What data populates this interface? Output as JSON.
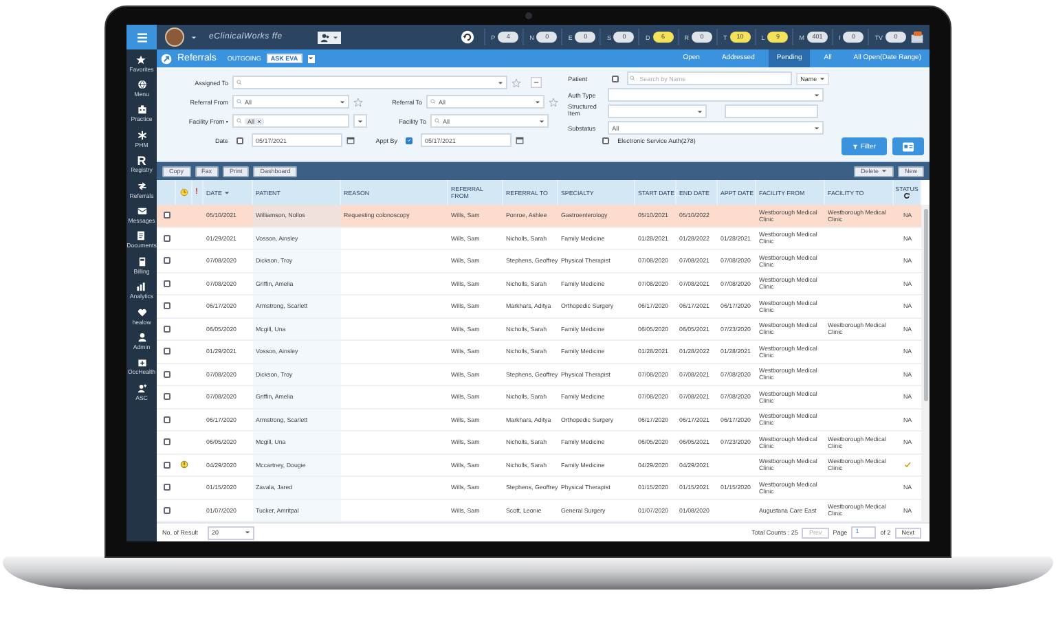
{
  "app": {
    "title": "eClinicalWorks ffe",
    "counters": [
      {
        "letter": "P",
        "count": "4",
        "highlighted": false
      },
      {
        "letter": "N",
        "count": "0",
        "highlighted": false
      },
      {
        "letter": "E",
        "count": "0",
        "highlighted": false
      },
      {
        "letter": "S",
        "count": "0",
        "highlighted": false
      },
      {
        "letter": "D",
        "count": "6",
        "highlighted": true
      },
      {
        "letter": "R",
        "count": "0",
        "highlighted": false
      },
      {
        "letter": "T",
        "count": "10",
        "highlighted": true
      },
      {
        "letter": "L",
        "count": "9",
        "highlighted": true
      },
      {
        "letter": "M",
        "count": "401",
        "highlighted": false
      },
      {
        "letter": "I",
        "count": "0",
        "highlighted": false
      },
      {
        "letter": "TV",
        "count": "0",
        "highlighted": false
      }
    ]
  },
  "sidebar": {
    "items": [
      {
        "label": "Favorites"
      },
      {
        "label": "Menu"
      },
      {
        "label": "Practice"
      },
      {
        "label": "PHM"
      },
      {
        "label": "Registry",
        "glyph": "R"
      },
      {
        "label": "Referrals"
      },
      {
        "label": "Messages"
      },
      {
        "label": "Documents"
      },
      {
        "label": "Billing"
      },
      {
        "label": "Analytics"
      },
      {
        "label": "healow"
      },
      {
        "label": "Admin"
      },
      {
        "label": "OccHealth"
      },
      {
        "label": "ASC"
      }
    ]
  },
  "module": {
    "title": "Referrals",
    "direction": "OUTGOING",
    "badge": "ASK EVA",
    "tabs": [
      {
        "label": "Open",
        "selected": false
      },
      {
        "label": "Addressed",
        "selected": false
      },
      {
        "label": "Pending",
        "selected": true
      },
      {
        "label": "All",
        "selected": false
      },
      {
        "label": "All Open(Date Range)",
        "selected": false
      }
    ]
  },
  "filters": {
    "assigned_to": {
      "label": "Assigned To"
    },
    "referral_from": {
      "label": "Referral From",
      "value": "All"
    },
    "referral_to": {
      "label": "Referral To",
      "value": "All"
    },
    "facility_from": {
      "label": "Facility From •",
      "chip": "All"
    },
    "facility_to": {
      "label": "Facility To",
      "value": "All"
    },
    "date": {
      "label": "Date",
      "checked": false,
      "value": "05/17/2021"
    },
    "appt_by": {
      "label": "Appt By",
      "checked": true,
      "value": "05/17/2021"
    },
    "patient": {
      "label": "Patient",
      "checked": false,
      "placeholder": "Search by Name",
      "mode": "Name"
    },
    "auth_type": {
      "label": "Auth Type"
    },
    "structured_item": {
      "label": "Structured Item"
    },
    "substatus": {
      "label": "Substatus",
      "value": "All"
    },
    "electronic_auth": {
      "label": "Electronic Service Auth(278)",
      "checked": false
    },
    "filter_button": "Filter"
  },
  "toolbar": {
    "buttons": [
      "Copy",
      "Fax",
      "Print",
      "Dashboard"
    ],
    "delete": "Delete",
    "new": "New"
  },
  "table": {
    "columns": [
      {
        "kind": "blank"
      },
      {
        "kind": "icon"
      },
      {
        "kind": "text",
        "label": "!"
      },
      {
        "kind": "text",
        "label": "DATE",
        "sorted": true
      },
      {
        "kind": "text",
        "label": "PATIENT"
      },
      {
        "kind": "text",
        "label": "REASON"
      },
      {
        "kind": "text",
        "label": "REFERRAL FROM"
      },
      {
        "kind": "text",
        "label": "REFERRAL TO"
      },
      {
        "kind": "text",
        "label": "SPECIALTY"
      },
      {
        "kind": "text",
        "label": "START DATE"
      },
      {
        "kind": "text",
        "label": "END DATE"
      },
      {
        "kind": "text",
        "label": "APPT DATE"
      },
      {
        "kind": "text",
        "label": "FACILITY FROM"
      },
      {
        "kind": "text",
        "label": "FACILITY TO"
      },
      {
        "kind": "text",
        "label": "STATUS",
        "refresh": true
      }
    ],
    "rows": [
      {
        "selected": true,
        "checked": false,
        "alert": false,
        "completed": false,
        "cells": [
          null,
          null,
          null,
          "05/10/2021",
          "Williamson, Nollos",
          "Requesting colonoscopy",
          "Wills, Sam",
          "Ponroe, Ashlee",
          "Gastroenterology",
          "05/10/2021",
          "05/10/2022",
          null,
          "Westborough Medical Clinic",
          "Westborough Medical Clinic",
          "NA"
        ]
      },
      {
        "selected": false,
        "checked": false,
        "alert": false,
        "completed": false,
        "cells": [
          null,
          null,
          null,
          "01/29/2021",
          "Vosson, Ainsley",
          null,
          "Wills, Sam",
          "Nicholls, Sarah",
          "Family Medicine",
          "01/28/2021",
          "01/28/2022",
          "01/28/2021",
          "Westborough Medical Clinic",
          null,
          "NA"
        ]
      },
      {
        "selected": false,
        "checked": false,
        "alert": false,
        "completed": false,
        "cells": [
          null,
          null,
          null,
          "07/08/2020",
          "Dickson, Troy",
          null,
          "Wills, Sam",
          "Stephens, Geoffrey",
          "Physical Therapist",
          "07/08/2020",
          "07/08/2021",
          "07/08/2020",
          "Westborough Medical Clinic",
          null,
          "NA"
        ]
      },
      {
        "selected": false,
        "checked": false,
        "alert": false,
        "completed": false,
        "cells": [
          null,
          null,
          null,
          "07/08/2020",
          "Griffin, Amelia",
          null,
          "Wills, Sam",
          "Nicholls, Sarah",
          "Family Medicine",
          "07/08/2020",
          "07/08/2021",
          "07/08/2020",
          "Westborough Medical Clinic",
          null,
          "NA"
        ]
      },
      {
        "selected": false,
        "checked": false,
        "alert": false,
        "completed": false,
        "cells": [
          null,
          null,
          null,
          "06/17/2020",
          "Armstrong, Scarlett",
          null,
          "Wills, Sam",
          "Markhars, Aditya",
          "Orthopedic Surgery",
          "06/17/2020",
          "06/17/2021",
          "06/17/2020",
          "Westborough Medical Clinic",
          null,
          "NA"
        ]
      },
      {
        "selected": false,
        "checked": false,
        "alert": false,
        "completed": false,
        "cells": [
          null,
          null,
          null,
          "06/05/2020",
          "Mcgill, Una",
          null,
          "Wills, Sam",
          "Nicholls, Sarah",
          "Family Medicine",
          "06/05/2020",
          "06/05/2021",
          "07/23/2020",
          "Westborough Medical Clinic",
          "Westborough Medical Clinic",
          "NA"
        ]
      },
      {
        "selected": false,
        "checked": false,
        "alert": false,
        "completed": false,
        "cells": [
          null,
          null,
          null,
          "01/29/2021",
          "Vosson, Ainsley",
          null,
          "Wills, Sam",
          "Nicholls, Sarah",
          "Family Medicine",
          "01/28/2021",
          "01/28/2022",
          "01/28/2021",
          "Westborough Medical Clinic",
          null,
          "NA"
        ]
      },
      {
        "selected": false,
        "checked": false,
        "alert": false,
        "completed": false,
        "cells": [
          null,
          null,
          null,
          "07/08/2020",
          "Dickson, Troy",
          null,
          "Wills, Sam",
          "Stephens, Geoffrey",
          "Physical Therapist",
          "07/08/2020",
          "07/08/2021",
          "07/08/2020",
          "Westborough Medical Clinic",
          null,
          "NA"
        ]
      },
      {
        "selected": false,
        "checked": false,
        "alert": false,
        "completed": false,
        "cells": [
          null,
          null,
          null,
          "07/08/2020",
          "Griffin, Amelia",
          null,
          "Wills, Sam",
          "Nicholls, Sarah",
          "Family Medicine",
          "07/08/2020",
          "07/08/2021",
          "07/08/2020",
          "Westborough Medical Clinic",
          null,
          "NA"
        ]
      },
      {
        "selected": false,
        "checked": false,
        "alert": false,
        "completed": false,
        "cells": [
          null,
          null,
          null,
          "06/17/2020",
          "Armstrong, Scarlett",
          null,
          "Wills, Sam",
          "Markhars, Aditya",
          "Orthopedic Surgery",
          "06/17/2020",
          "06/17/2021",
          "06/17/2020",
          "Westborough Medical Clinic",
          null,
          "NA"
        ]
      },
      {
        "selected": false,
        "checked": false,
        "alert": false,
        "completed": false,
        "cells": [
          null,
          null,
          null,
          "06/05/2020",
          "Mcgill, Una",
          null,
          "Wills, Sam",
          "Nicholls, Sarah",
          "Family Medicine",
          "06/05/2020",
          "06/05/2021",
          "07/23/2020",
          "Westborough Medical Clinic",
          "Westborough Medical Clinic",
          "NA"
        ]
      },
      {
        "selected": false,
        "checked": false,
        "alert": true,
        "completed": true,
        "cells": [
          null,
          null,
          null,
          "04/29/2020",
          "Mccartney, Dougie",
          null,
          "Wills, Sam",
          "Nicholls, Sarah",
          "Family Medicine",
          "04/29/2020",
          "04/29/2021",
          null,
          "Westborough Medical Clinic",
          "Westborough Medical Clinic",
          null
        ]
      },
      {
        "selected": false,
        "checked": false,
        "alert": false,
        "completed": false,
        "cells": [
          null,
          null,
          null,
          "01/15/2020",
          "Zavala, Jared",
          null,
          "Wills, Sam",
          "Stephens, Geoffrey",
          "Physical Therapist",
          "01/15/2020",
          "01/15/2021",
          "01/15/2020",
          "Westborough Medical Clinic",
          null,
          "NA"
        ]
      },
      {
        "selected": false,
        "checked": false,
        "alert": false,
        "completed": false,
        "cells": [
          null,
          null,
          null,
          "01/07/2020",
          "Tucker, Amritpal",
          null,
          "Wills, Sam",
          "Scott, Leonie",
          "General Surgery",
          "01/07/2020",
          "01/08/2020",
          null,
          "Augustana Care East",
          "Westborough Medical Clinic",
          "NA"
        ]
      }
    ]
  },
  "footer": {
    "result_label": "No. of Result",
    "result_count": "20",
    "total": "Total Counts : 25",
    "prev": "Prev",
    "page_label": "Page",
    "page": "1",
    "page_of": "of 2",
    "next": "Next"
  }
}
